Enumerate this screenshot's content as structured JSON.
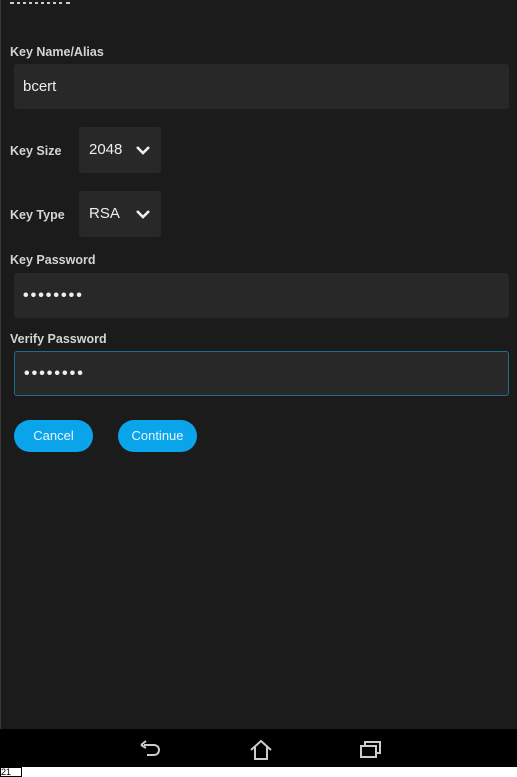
{
  "form": {
    "key_name_label": "Key Name/Alias",
    "key_name_value": "bcert",
    "key_size_label": "Key Size",
    "key_size_value": "2048",
    "key_type_label": "Key Type",
    "key_type_value": "RSA",
    "key_password_label": "Key Password",
    "key_password_value": "••••••••",
    "verify_password_label": "Verify Password",
    "verify_password_value": "••••••••"
  },
  "buttons": {
    "cancel": "Cancel",
    "continue": "Continue"
  },
  "nav": {
    "icons": [
      "back-icon",
      "home-icon",
      "recent-apps-icon"
    ]
  },
  "status": {
    "clock_fragment": "21"
  },
  "colors": {
    "accent": "#0aa4ea",
    "background": "#1b1b1b",
    "field": "#282828"
  }
}
